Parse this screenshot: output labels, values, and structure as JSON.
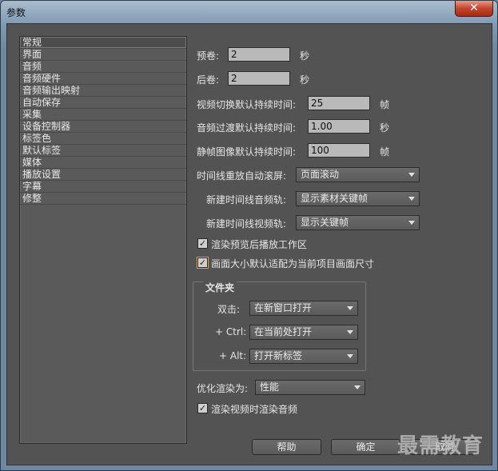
{
  "window": {
    "title": "参数",
    "close_label": "✕"
  },
  "sidebar": {
    "items": [
      "常规",
      "界面",
      "音频",
      "音频硬件",
      "音频输出映射",
      "自动保存",
      "采集",
      "设备控制器",
      "标签色",
      "默认标签",
      "媒体",
      "播放设置",
      "字幕",
      "修整"
    ],
    "selected": "常规"
  },
  "general": {
    "preroll_label": "预卷:",
    "preroll_value": "2",
    "preroll_unit": "秒",
    "postroll_label": "后卷:",
    "postroll_value": "2",
    "postroll_unit": "秒",
    "video_transition_label": "视频切换默认持续时间:",
    "video_transition_value": "25",
    "video_transition_unit": "帧",
    "audio_crossfade_label": "音频过渡默认持续时间:",
    "audio_crossfade_value": "1.00",
    "audio_crossfade_unit": "秒",
    "still_image_label": "静帧图像默认持续时间:",
    "still_image_value": "100",
    "still_image_unit": "帧",
    "timeline_scroll_label": "时间线重放自动滚屏:",
    "timeline_scroll_value": "页面滚动",
    "new_audio_track_label": "新建时间线音频轨:",
    "new_audio_track_value": "显示素材关键帧",
    "new_video_track_label": "新建时间线视频轨:",
    "new_video_track_value": "显示关键帧",
    "render_preview_label": "渲染预览后播放工作区",
    "render_preview_checked": true,
    "scale_to_frame_label": "画面大小默认适配为当前项目画面尺寸",
    "scale_to_frame_checked": true
  },
  "bins": {
    "title": "文件夹",
    "double_click_label": "双击:",
    "double_click_value": "在新窗口打开",
    "ctrl_label": "+ Ctrl:",
    "ctrl_value": "在当前处打开",
    "alt_label": "+ Alt:",
    "alt_value": "打开新标签"
  },
  "optimize": {
    "label": "优化渲染为:",
    "value": "性能",
    "render_audio_label": "渲染视频时渲染音频",
    "render_audio_checked": true
  },
  "footer": {
    "help_label": "帮助",
    "ok_label": "确定",
    "cancel_label": "取消"
  },
  "watermark": "最需教育"
}
